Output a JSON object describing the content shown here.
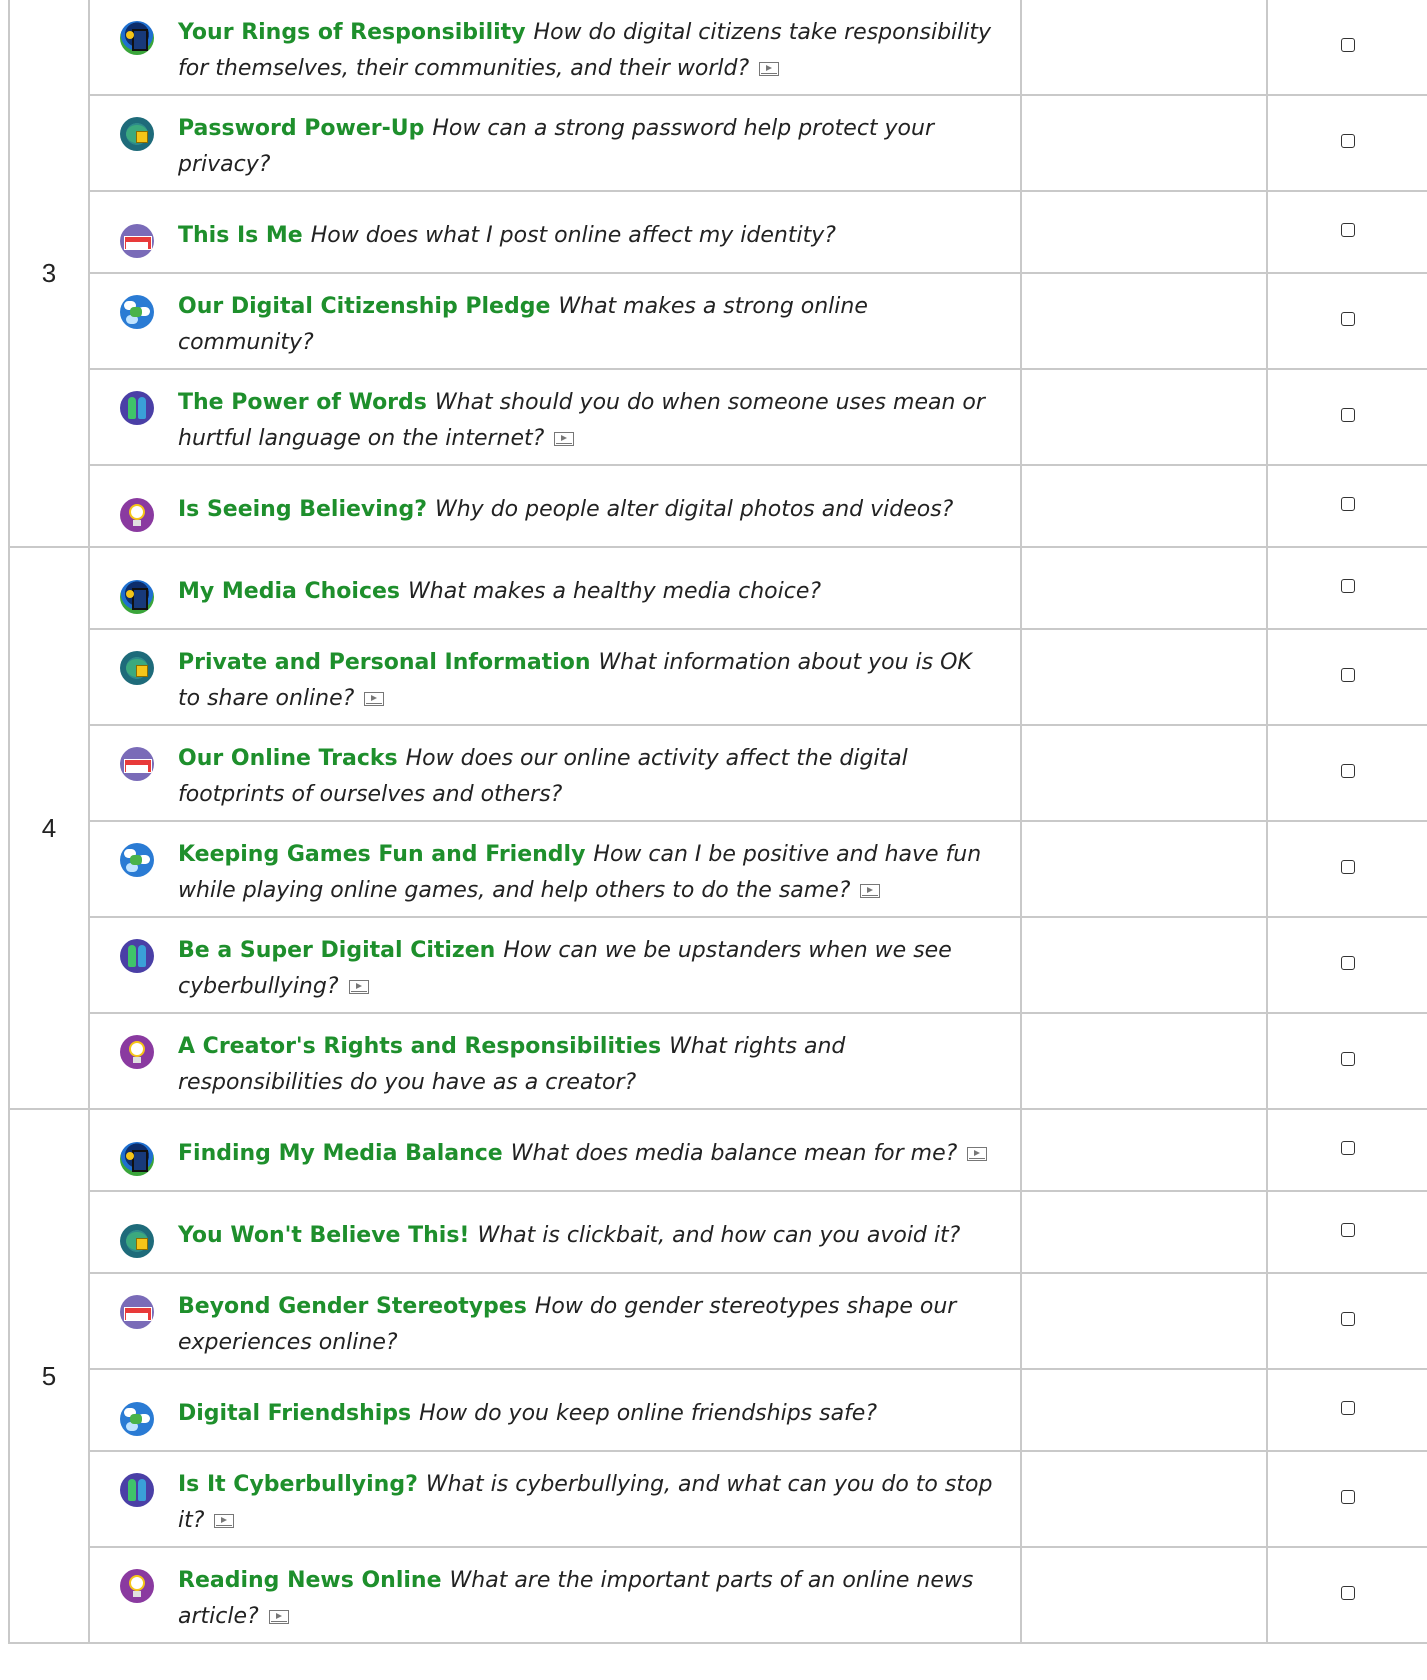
{
  "grades": [
    {
      "grade": "3",
      "lessons": [
        {
          "icon": "media-balance-icon",
          "badge": "b-balance",
          "title": "Your Rings of Responsibility",
          "question": "How do digital citizens take responsibility for themselves, their communities, and their world?",
          "video": true,
          "height": 96
        },
        {
          "icon": "privacy-security-icon",
          "badge": "b-privacy",
          "title": "Password Power-Up",
          "question": "How can a strong password help protect your privacy?",
          "video": false,
          "height": 96
        },
        {
          "icon": "digital-footprint-icon",
          "badge": "b-identity",
          "title": "This Is Me",
          "question": "How does what I post online affect my identity?",
          "video": false,
          "height": 82
        },
        {
          "icon": "relationships-icon",
          "badge": "b-relationships",
          "title": "Our Digital Citizenship Pledge",
          "question": "What makes a strong online community?",
          "video": false,
          "height": 96
        },
        {
          "icon": "cyberbullying-icon",
          "badge": "b-cyberbullying",
          "title": "The Power of Words",
          "question": "What should you do when someone uses mean or hurtful language on the internet?",
          "video": true,
          "height": 96
        },
        {
          "icon": "news-literacy-icon",
          "badge": "b-news",
          "title": "Is Seeing Believing?",
          "question": "Why do people alter digital photos and videos?",
          "video": false,
          "height": 82
        }
      ]
    },
    {
      "grade": "4",
      "lessons": [
        {
          "icon": "media-balance-icon",
          "badge": "b-balance",
          "title": "My Media Choices",
          "question": "What makes a healthy media choice?",
          "video": false,
          "height": 82
        },
        {
          "icon": "privacy-security-icon",
          "badge": "b-privacy",
          "title": "Private and Personal Information",
          "question": "What information about you is OK to share online?",
          "video": true,
          "height": 96
        },
        {
          "icon": "digital-footprint-icon",
          "badge": "b-identity",
          "title": "Our Online Tracks",
          "question": "How does our online activity affect the digital footprints of ourselves and others?",
          "video": false,
          "height": 96
        },
        {
          "icon": "relationships-icon",
          "badge": "b-relationships",
          "title": "Keeping Games Fun and Friendly",
          "question": "How can I be positive and have fun while playing online games, and help others to do the same?",
          "video": true,
          "height": 96
        },
        {
          "icon": "cyberbullying-icon",
          "badge": "b-cyberbullying",
          "title": "Be a Super Digital Citizen",
          "question": "How can we be upstanders when we see cyberbullying?",
          "video": true,
          "height": 96
        },
        {
          "icon": "news-literacy-icon",
          "badge": "b-news",
          "title": "A Creator's Rights and Responsibilities",
          "question": "What rights and responsibilities do you have as a creator?",
          "video": false,
          "height": 96
        }
      ]
    },
    {
      "grade": "5",
      "lessons": [
        {
          "icon": "media-balance-icon",
          "badge": "b-balance",
          "title": "Finding My Media Balance",
          "question": "What does media balance mean for me?",
          "video": true,
          "height": 82
        },
        {
          "icon": "privacy-security-icon",
          "badge": "b-privacy",
          "title": "You Won't Believe This!",
          "question": "What is clickbait, and how can you avoid it?",
          "video": false,
          "height": 82
        },
        {
          "icon": "digital-footprint-icon",
          "badge": "b-identity",
          "title": "Beyond Gender Stereotypes",
          "question": "How do gender stereotypes shape our experiences online?",
          "video": false,
          "height": 96
        },
        {
          "icon": "relationships-icon",
          "badge": "b-relationships",
          "title": "Digital Friendships",
          "question": "How do you keep online friendships safe?",
          "video": false,
          "height": 82
        },
        {
          "icon": "cyberbullying-icon",
          "badge": "b-cyberbullying",
          "title": "Is It Cyberbullying?",
          "question": "What is cyberbullying, and what can you do to stop it?",
          "video": true,
          "height": 96
        },
        {
          "icon": "news-literacy-icon",
          "badge": "b-news",
          "title": "Reading News Online",
          "question": "What are the important parts of an online news article?",
          "video": true,
          "height": 96
        }
      ]
    }
  ]
}
